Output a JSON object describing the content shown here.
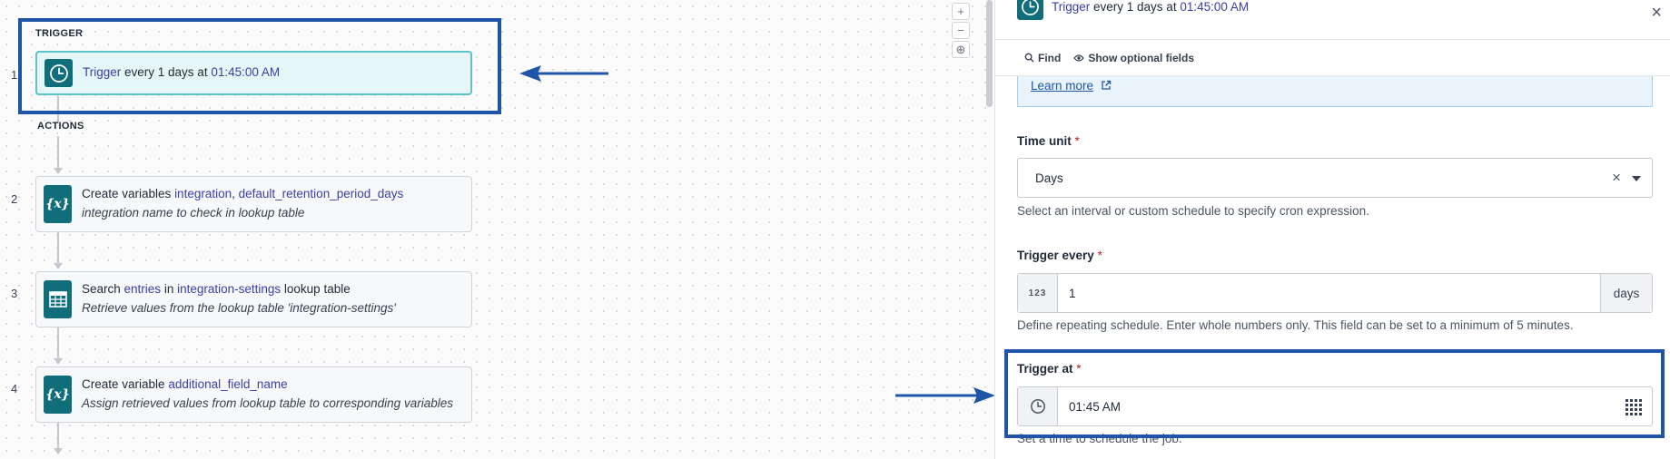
{
  "canvas": {
    "trigger_section": "TRIGGER",
    "actions_section": "ACTIONS",
    "steps": [
      {
        "number": "1",
        "parts": [
          {
            "text": "Trigger",
            "pill": true
          },
          {
            "text": " every 1 days at ",
            "pill": false
          },
          {
            "text": "01:45:00 AM",
            "pill": true
          }
        ],
        "subtitle": ""
      },
      {
        "number": "2",
        "parts": [
          {
            "text": "Create variables ",
            "pill": false
          },
          {
            "text": "integration",
            "pill": true
          },
          {
            "text": ", ",
            "pill": false
          },
          {
            "text": "default_retention_period_days",
            "pill": true
          }
        ],
        "subtitle": "integration name to check in lookup table"
      },
      {
        "number": "3",
        "parts": [
          {
            "text": "Search ",
            "pill": false
          },
          {
            "text": "entries",
            "pill": true
          },
          {
            "text": " in ",
            "pill": false
          },
          {
            "text": "integration-settings",
            "pill": true
          },
          {
            "text": " lookup table",
            "pill": false
          }
        ],
        "subtitle": "Retrieve values from the lookup table 'integration-settings'"
      },
      {
        "number": "4",
        "parts": [
          {
            "text": "Create variable ",
            "pill": false
          },
          {
            "text": "additional_field_name",
            "pill": true
          }
        ],
        "subtitle": "Assign retrieved values from lookup table to corresponding variables"
      }
    ],
    "zoom_controls": [
      "+",
      "−",
      "⊕"
    ],
    "variable_icon_text": "{x}"
  },
  "panel": {
    "header": {
      "parts": [
        {
          "text": "Trigger",
          "pill": true
        },
        {
          "text": " every 1 days at ",
          "pill": false
        },
        {
          "text": "01:45:00 AM",
          "pill": true
        }
      ],
      "close": "×"
    },
    "toolbar": {
      "find_label": "Find",
      "optional_label": "Show optional fields"
    },
    "info": {
      "learn_more": "Learn more"
    },
    "time_unit": {
      "label": "Time unit",
      "required": "*",
      "value": "Days",
      "clear": "×",
      "help": "Select an interval or custom schedule to specify cron expression."
    },
    "trigger_every": {
      "label": "Trigger every",
      "required": "*",
      "prefix": "123",
      "value": "1",
      "suffix": "days",
      "help": "Define repeating schedule. Enter whole numbers only. This field can be set to a minimum of 5 minutes."
    },
    "trigger_at": {
      "label": "Trigger at",
      "required": "*",
      "value": "01:45 AM",
      "help": "Set a time to schedule the job."
    }
  },
  "colors": {
    "teal_icon": "#0f6e7a",
    "pill_text": "#3b3fa8",
    "highlight_blue": "#1f55a8",
    "trigger_card_bg": "#e6f6f6",
    "trigger_card_border": "#5cc3c6",
    "required_red": "#c81e1e"
  },
  "icons": {
    "trigger": "clock-icon",
    "variables": "braces-x-icon",
    "lookup": "table-icon",
    "find": "search-icon",
    "optional": "eye-icon",
    "external": "external-link-icon",
    "time_picker": "grid-dots-icon"
  }
}
